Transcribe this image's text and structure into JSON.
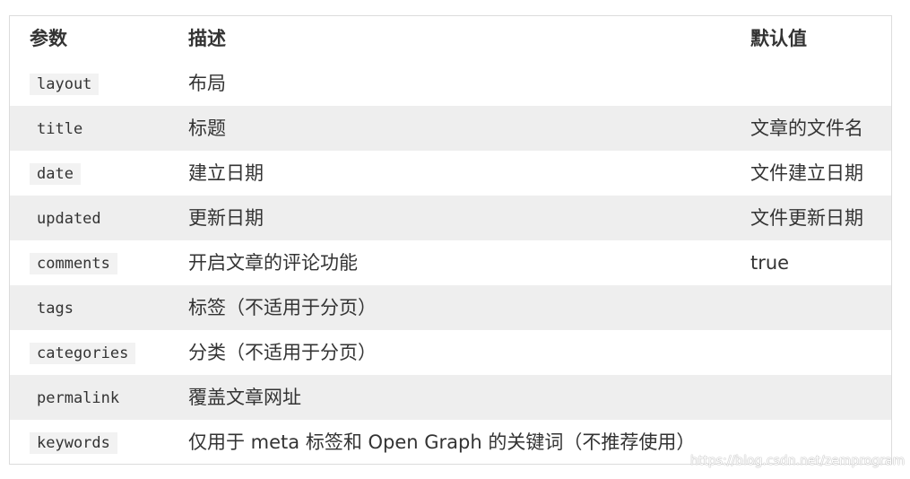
{
  "table": {
    "headers": {
      "param": "参数",
      "desc": "描述",
      "default": "默认值"
    },
    "rows": [
      {
        "param": "layout",
        "desc": "布局",
        "default": ""
      },
      {
        "param": "title",
        "desc": "标题",
        "default": "文章的文件名"
      },
      {
        "param": "date",
        "desc": "建立日期",
        "default": "文件建立日期"
      },
      {
        "param": "updated",
        "desc": "更新日期",
        "default": "文件更新日期"
      },
      {
        "param": "comments",
        "desc": "开启文章的评论功能",
        "default": "true"
      },
      {
        "param": "tags",
        "desc": "标签（不适用于分页）",
        "default": ""
      },
      {
        "param": "categories",
        "desc": "分类（不适用于分页）",
        "default": ""
      },
      {
        "param": "permalink",
        "desc": "覆盖文章网址",
        "default": ""
      },
      {
        "param": "keywords",
        "desc": "仅用于 meta 标签和 Open Graph 的关键词（不推荐使用）",
        "default": ""
      }
    ]
  },
  "watermark": "https://blog.csdn.net/zemprogram"
}
